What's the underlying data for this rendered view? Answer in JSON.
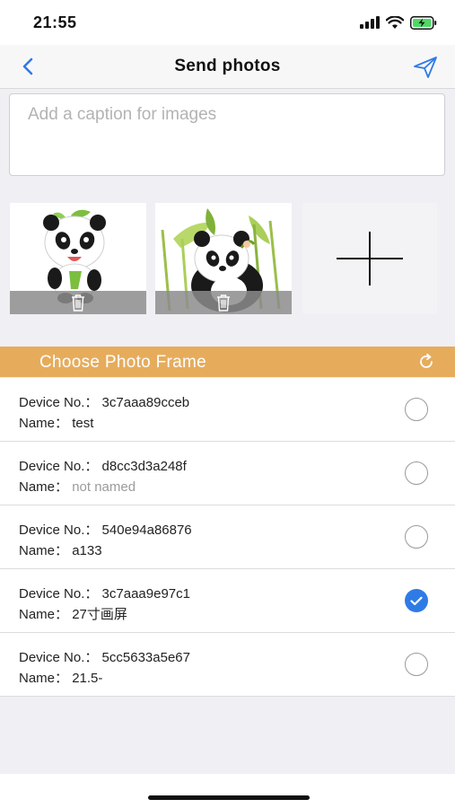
{
  "status_bar": {
    "time": "21:55"
  },
  "nav": {
    "title": "Send photos"
  },
  "caption": {
    "placeholder": "Add a caption for images",
    "value": ""
  },
  "photos": [
    {
      "icon": "panda-photo",
      "delete_icon": "trash-icon"
    },
    {
      "icon": "panda-bamboo-photo",
      "delete_icon": "trash-icon"
    }
  ],
  "add_photo": {
    "icon": "plus-icon"
  },
  "frame_section": {
    "title": "Choose Photo Frame",
    "refresh_icon": "refresh-icon"
  },
  "colors": {
    "accent": "#e6ac5c",
    "selected": "#2f7be5",
    "nav_blue": "#2f7be5"
  },
  "devices": [
    {
      "device_label": "Device No.：",
      "device_no": "3c7aaa89cceb",
      "name_label": "Name：",
      "name": "test",
      "selected": false
    },
    {
      "device_label": "Device No.：",
      "device_no": "d8cc3d3a248f",
      "name_label": "Name：",
      "name": "not named",
      "selected": false
    },
    {
      "device_label": "Device No.：",
      "device_no": "540e94a86876",
      "name_label": "Name：",
      "name": "a133",
      "selected": false
    },
    {
      "device_label": "Device No.：",
      "device_no": "3c7aaa9e97c1",
      "name_label": "Name：",
      "name": "27寸画屏",
      "selected": true
    },
    {
      "device_label": "Device No.：",
      "device_no": "5cc5633a5e67",
      "name_label": "Name：",
      "name": "21.5-",
      "selected": false
    }
  ]
}
